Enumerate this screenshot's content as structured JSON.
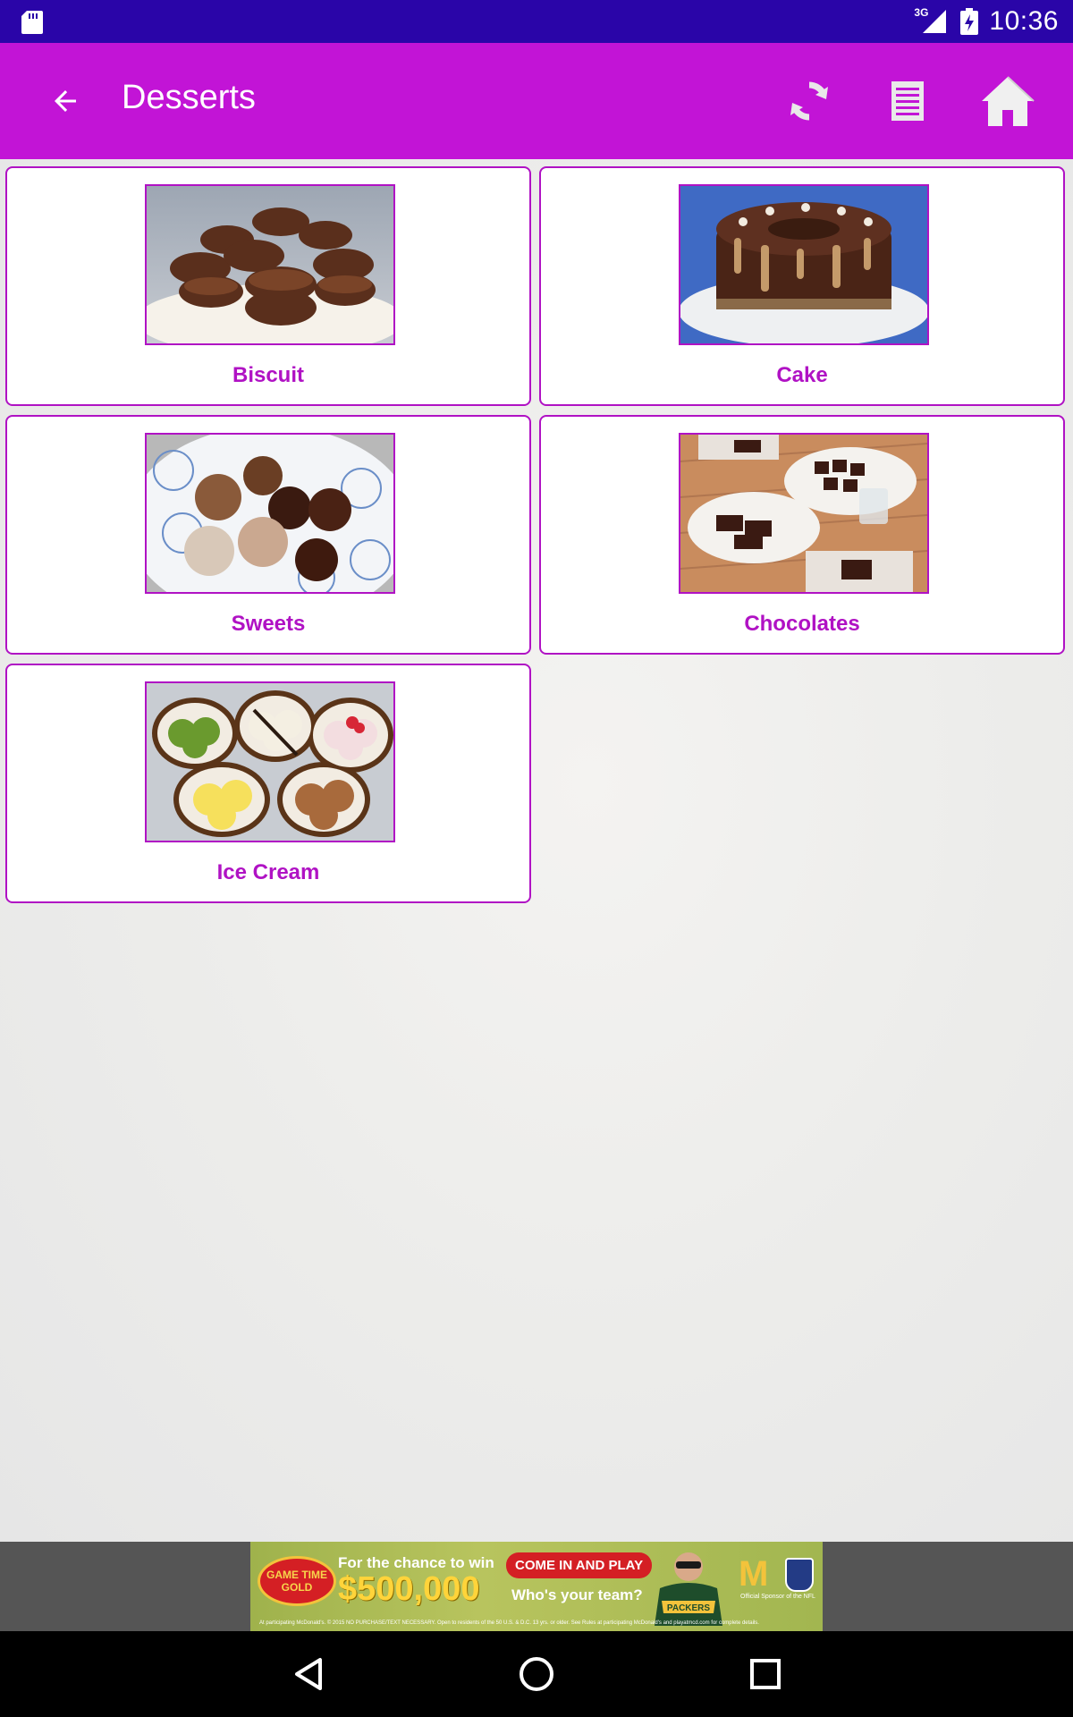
{
  "status_bar": {
    "network": "3G",
    "time": "10:36"
  },
  "app_bar": {
    "title": "Desserts",
    "actions": [
      {
        "icon": "refresh-icon"
      },
      {
        "icon": "list-icon"
      },
      {
        "icon": "home-icon"
      }
    ]
  },
  "categories": [
    {
      "label": "Biscuit",
      "image": "biscuit-image"
    },
    {
      "label": "Cake",
      "image": "cake-image"
    },
    {
      "label": "Sweets",
      "image": "sweets-image"
    },
    {
      "label": "Chocolates",
      "image": "chocolates-image"
    },
    {
      "label": "Ice Cream",
      "image": "ice-cream-image"
    }
  ],
  "ad": {
    "badge": "GAME TIME GOLD",
    "chance": "For the chance to win",
    "amount": "$500,000",
    "cta": "COME IN AND PLAY",
    "question": "Who's your team?",
    "jersey": "PACKERS",
    "sponsor": "Official Sponsor of the NFL",
    "fine_print": "At participating McDonald's. © 2015 NO PURCHASE/TEXT NECESSARY. Open to residents of the 50 U.S. & D.C. 13 yrs. or older. See Rules at participating McDonald's and playatmcd.com for complete details."
  },
  "colors": {
    "status_bar": "#2a05a8",
    "app_bar": "#c214d6",
    "accent": "#b012c4"
  }
}
